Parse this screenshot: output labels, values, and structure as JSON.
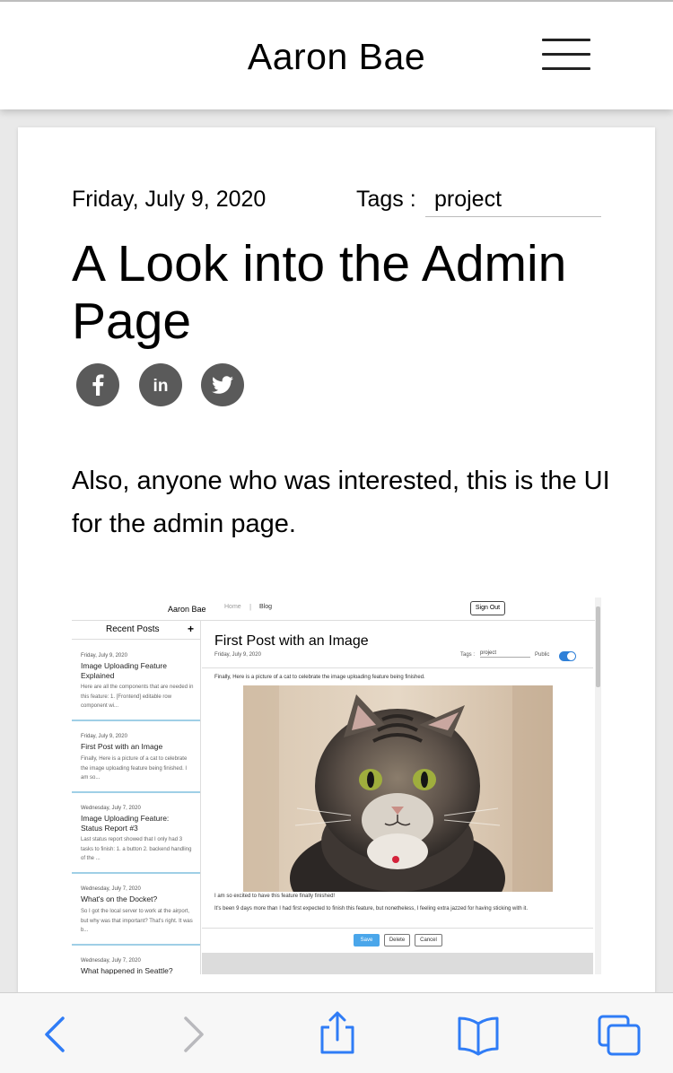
{
  "header": {
    "site_title": "Aaron Bae",
    "menu_icon": "hamburger-menu-icon"
  },
  "post": {
    "date": "Friday, July 9, 2020",
    "tags_label": "Tags :",
    "tag": "project",
    "title": "A Look into the Admin Page",
    "share_icons": [
      "facebook-icon",
      "linkedin-icon",
      "twitter-icon"
    ],
    "body": "Also, anyone who was interested, this is the UI for the admin page."
  },
  "screenshot": {
    "nav": {
      "brand": "Aaron Bae",
      "home": "Home",
      "separator": "|",
      "blog": "Blog",
      "sign_out": "Sign Out"
    },
    "sidebar": {
      "header": "Recent Posts",
      "add": "+",
      "items": [
        {
          "date": "Friday, July 9, 2020",
          "title": "Image Uploading Feature Explained",
          "excerpt": "Here are all the components that are needed in this feature: 1. [Frontend] editable row component wi..."
        },
        {
          "date": "Friday, July 9, 2020",
          "title": "First Post with an Image",
          "excerpt": "Finally, Here is a picture of a cat to celebrate the image uploading feature being finished. I am so..."
        },
        {
          "date": "Wednesday, July 7, 2020",
          "title": "Image Uploading Feature: Status Report #3",
          "excerpt": "Last status report showed that I only had 3 tasks to finish: 1. a button 2. backend handling of the ..."
        },
        {
          "date": "Wednesday, July 7, 2020",
          "title": "What's on the Docket?",
          "excerpt": "So I got the local server to work at the airport, but why was that important? That's right. It was b..."
        },
        {
          "date": "Wednesday, July 7, 2020",
          "title": "What happened in Seattle?",
          "excerpt": ""
        }
      ]
    },
    "editor": {
      "title": "First Post with an Image",
      "date": "Friday, July 9, 2020",
      "tags_label": "Tags :",
      "tag": "project",
      "public_label": "Public",
      "public_on": true,
      "intro": "Finally, Here is a picture of a cat to celebrate the image uploading feature being finished.",
      "line1": "I am so excited to have this feature finally finished!",
      "line2": "It's been 9 days more than I had first expected to finish this feature, but nonetheless, I feeling extra jazzed for having sticking with it.",
      "save": "Save",
      "delete": "Delete",
      "cancel": "Cancel"
    }
  },
  "browser_toolbar": {
    "icons": [
      "back-icon",
      "forward-icon",
      "share-icon",
      "bookmarks-icon",
      "tabs-icon"
    ],
    "accent": "#2f7cf6",
    "disabled": "#b9b9bd"
  }
}
